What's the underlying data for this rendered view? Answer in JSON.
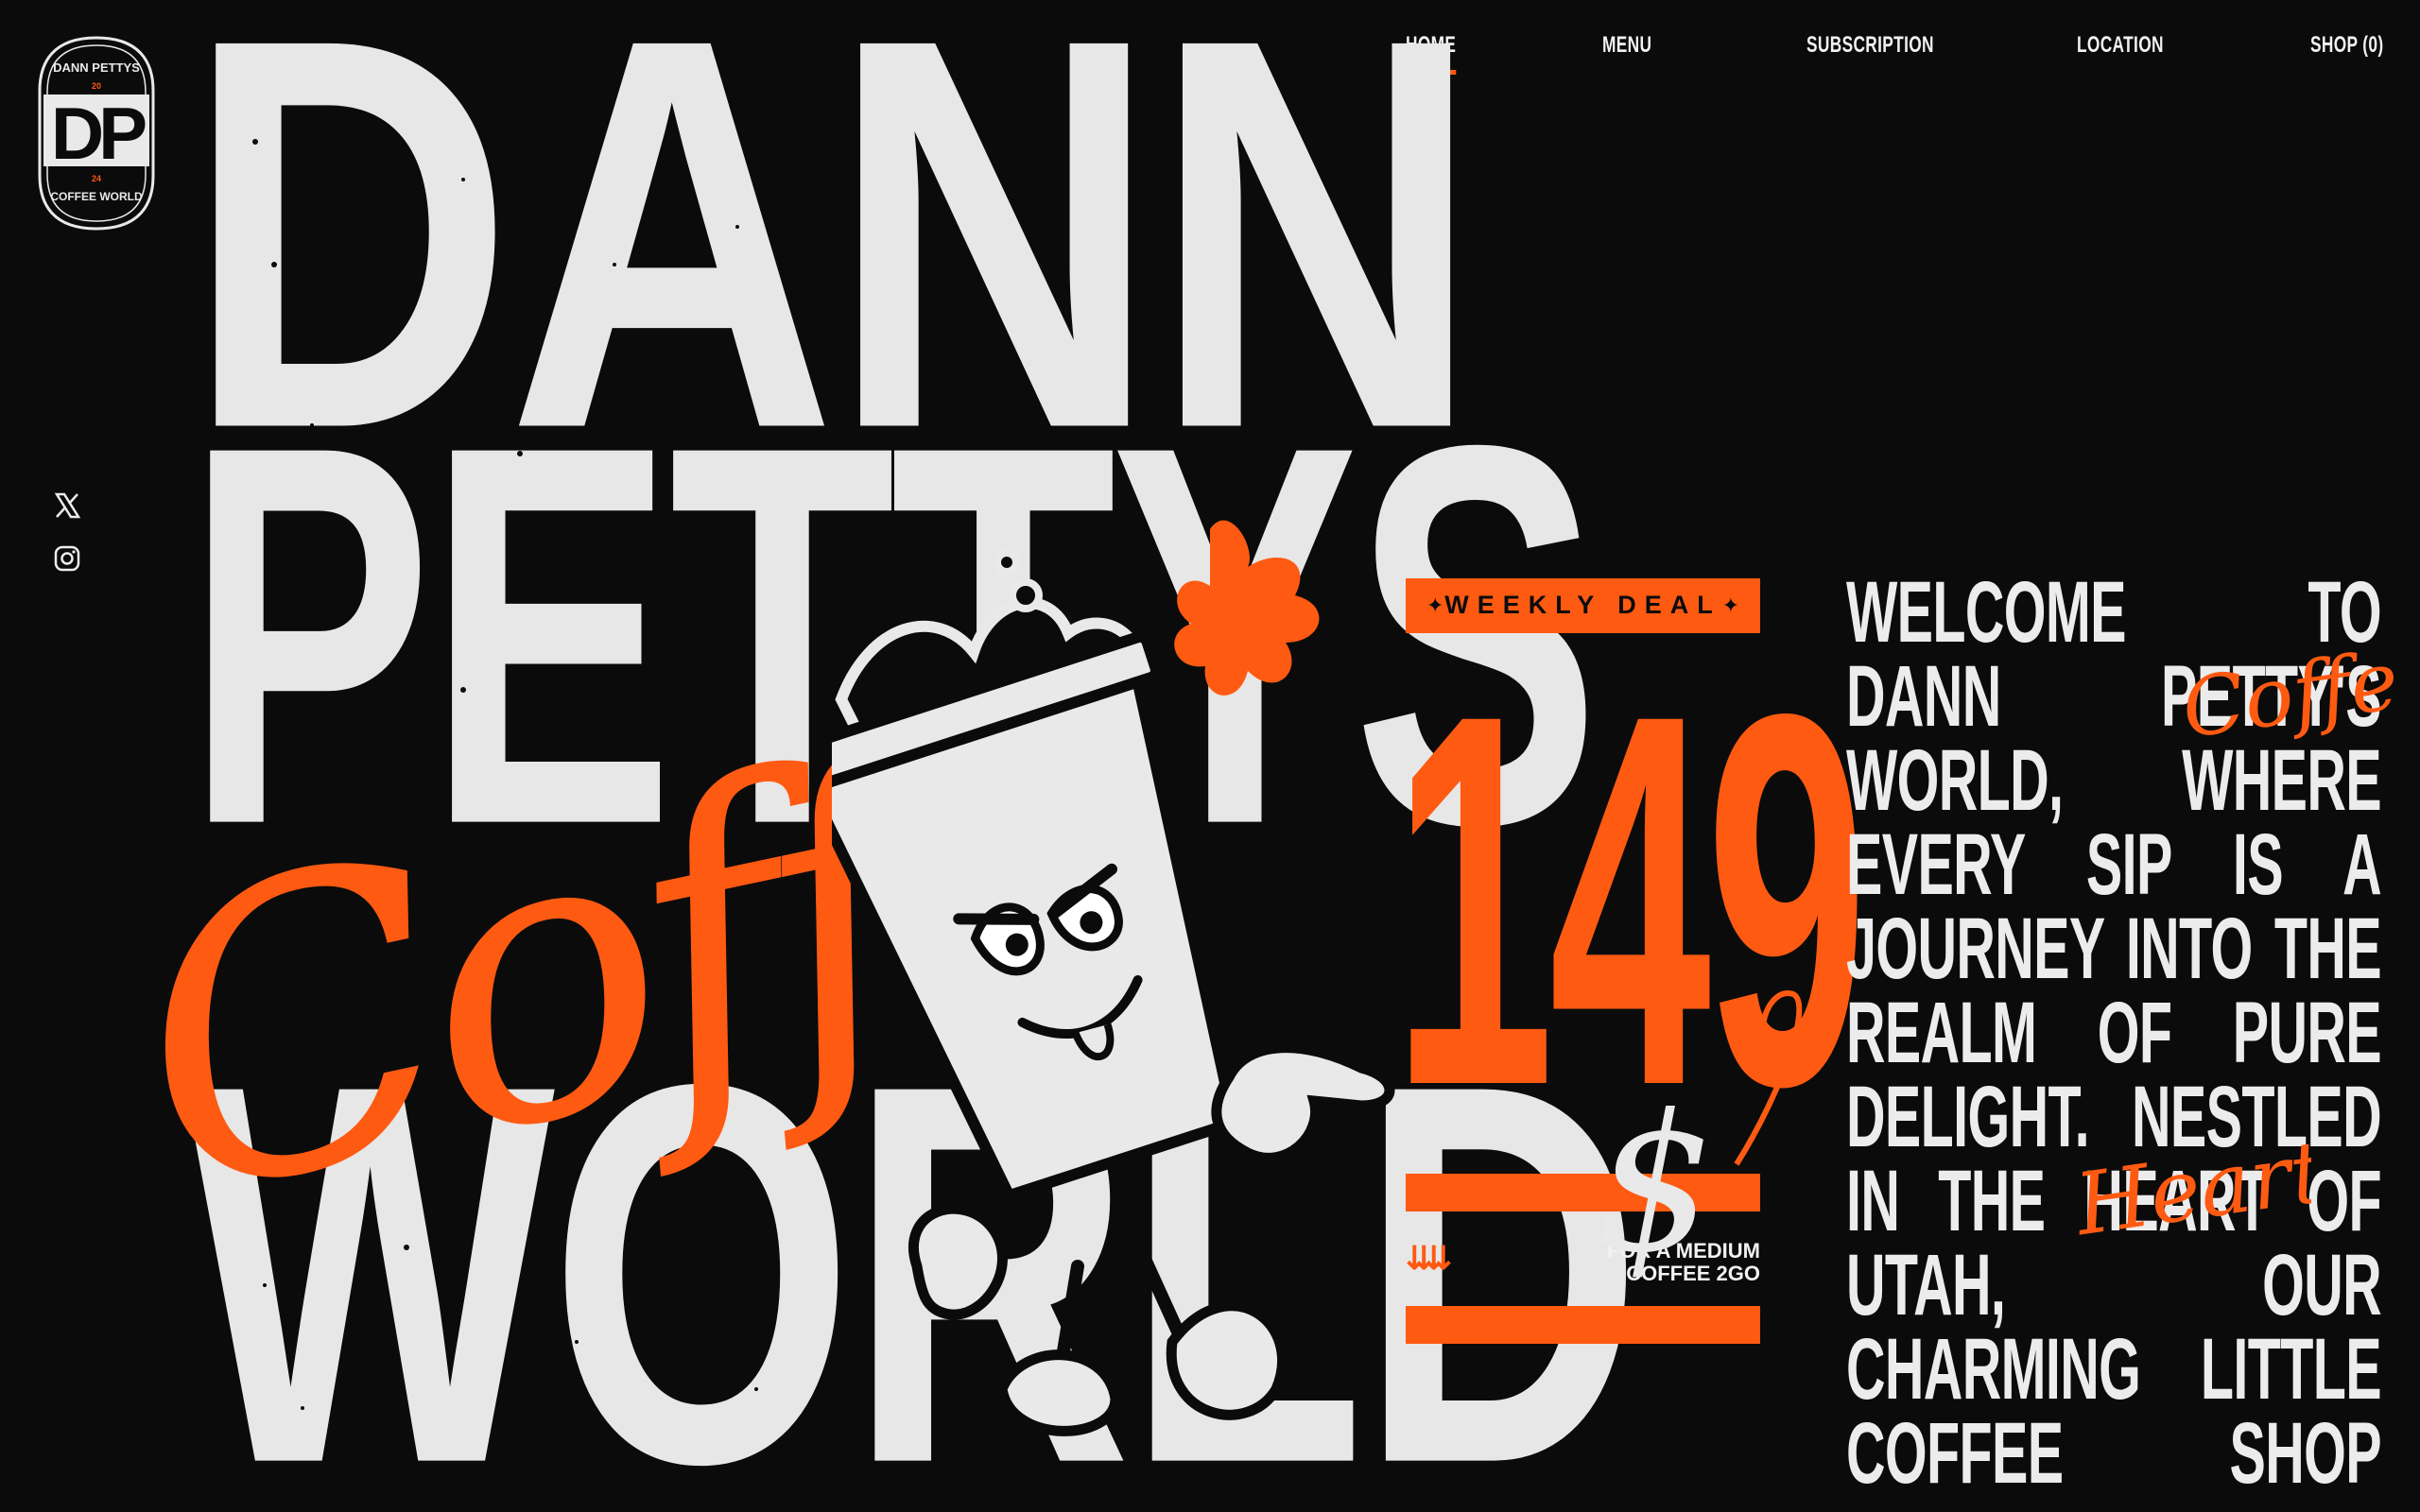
{
  "brand": {
    "logo_letters": "DP",
    "logo_top_text": "DANN PETTYS",
    "logo_bottom_text": "COFFEE WORLD",
    "logo_year_top": "20",
    "logo_year_bottom": "24"
  },
  "nav": {
    "items": [
      {
        "label": "HOME",
        "active": true
      },
      {
        "label": "MENU",
        "active": false
      },
      {
        "label": "SUBSCRIPTION",
        "active": false
      },
      {
        "label": "LOCATION",
        "active": false
      },
      {
        "label": "SHOP (0)",
        "active": false
      }
    ]
  },
  "social": {
    "icons": [
      "x-icon",
      "instagram-icon"
    ]
  },
  "hero": {
    "line1": "DANN",
    "line2": "PETTYS",
    "line3": "WORLD",
    "script_word": "Coffe"
  },
  "deal": {
    "banner": "WEEKLY DEAL",
    "price": "149",
    "currency": "$",
    "note_line1": "FOR A MEDIUM",
    "note_line2": "COFFEE 2GO"
  },
  "welcome": {
    "text": "WELCOME TO DANN PETTY'S WORLD, WHERE EVERY SIP IS A JOURNEY INTO THE REALM OF PURE DELIGHT. NESTLED IN THE HEART OF UTAH, OUR CHARMING LITTLE COFFEE SHOP",
    "script_coffee": "Coffee",
    "script_heart": "Heart"
  },
  "colors": {
    "accent": "#ff5a12",
    "background": "#0b0b0b",
    "text": "#e9e9e9"
  }
}
